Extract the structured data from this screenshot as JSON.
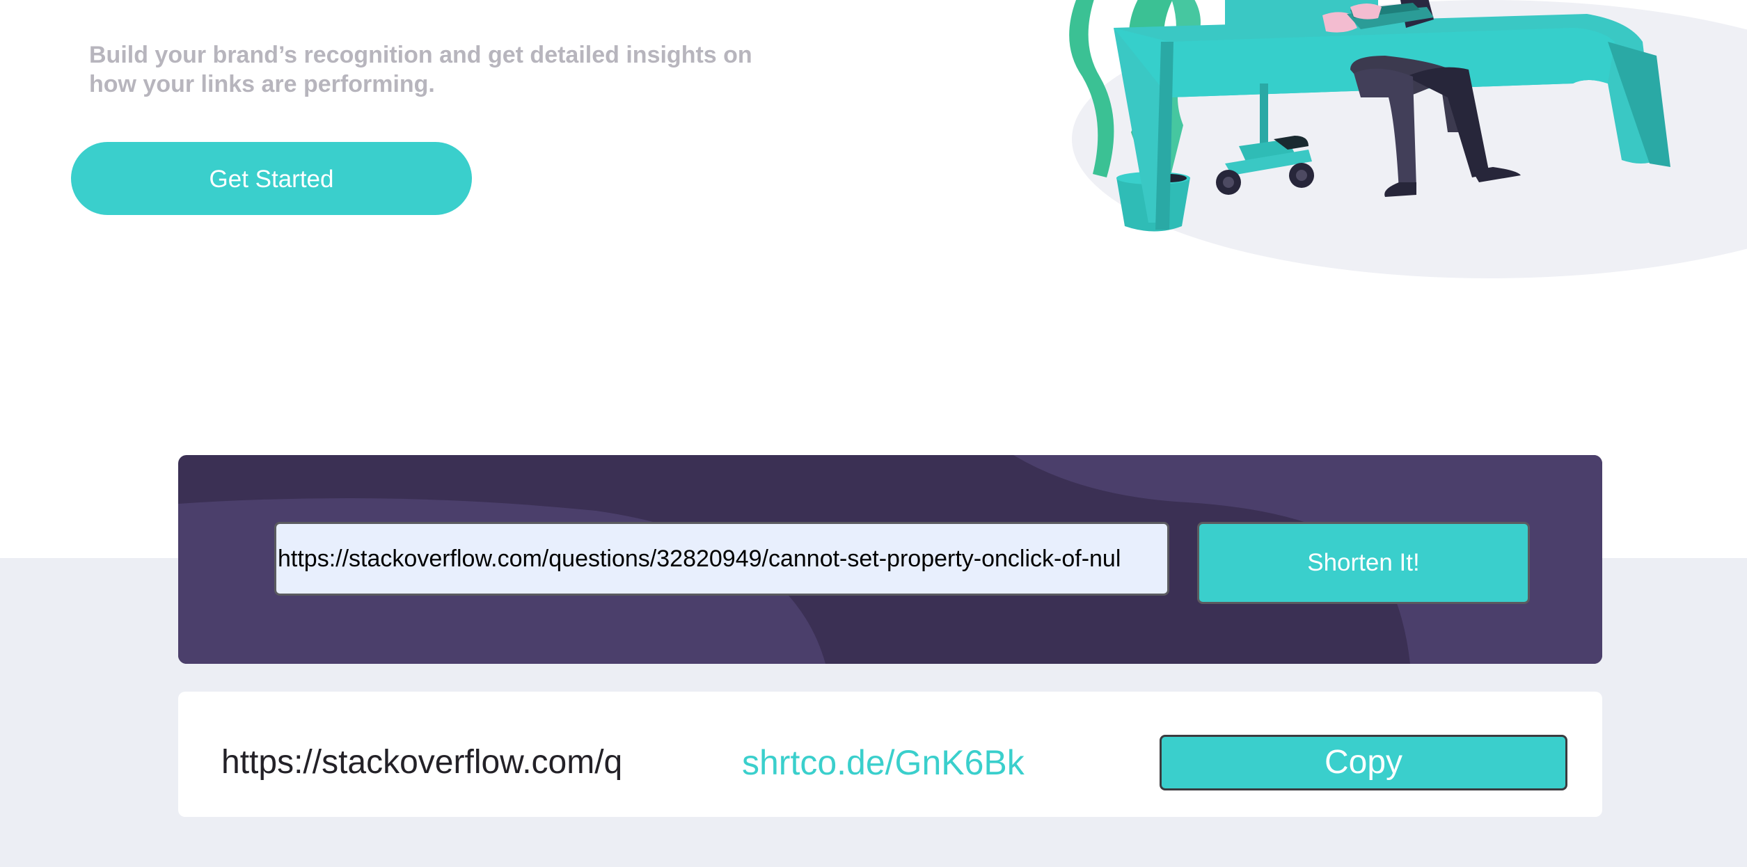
{
  "hero": {
    "description_line1": "Build your brand’s recognition and get detailed insights on",
    "description_line2": "how your links are performing.",
    "cta_label": "Get Started"
  },
  "shortener": {
    "input_value": "https://stackoverflow.com/questions/32820949/cannot-set-property-onclick-of-nul",
    "button_label": "Shorten It!"
  },
  "result": {
    "original_url": "https://stackoverflow.com/q",
    "short_url": "shrtco.de/GnK6Bk",
    "copy_label": "Copy"
  },
  "colors": {
    "accent": "#3acfcc",
    "dark_violet": "#3b3054",
    "text_gray": "#b7b5bd",
    "background_gray": "#eceef4"
  }
}
